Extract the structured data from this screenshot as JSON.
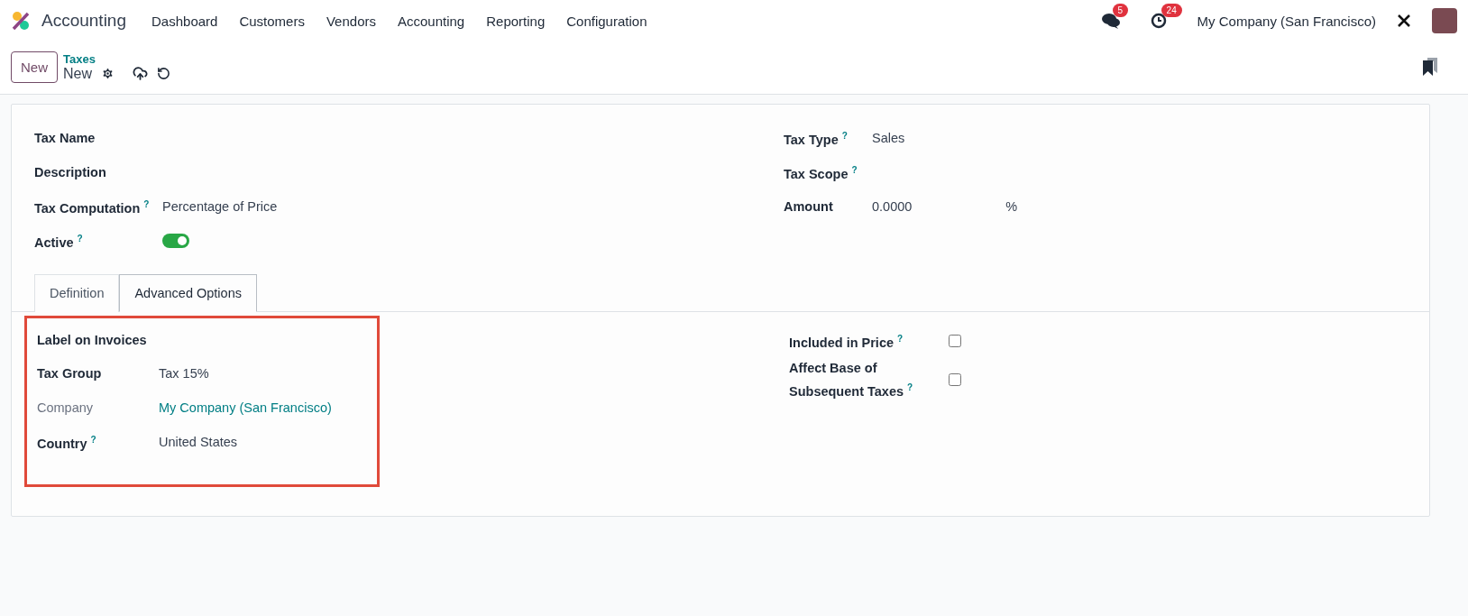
{
  "navbar": {
    "app_name": "Accounting",
    "menu": [
      "Dashboard",
      "Customers",
      "Vendors",
      "Accounting",
      "Reporting",
      "Configuration"
    ],
    "messages_count": "5",
    "activities_count": "24",
    "company": "My Company (San Francisco)"
  },
  "control_panel": {
    "new_button": "New",
    "breadcrumb_parent": "Taxes",
    "breadcrumb_current": "New"
  },
  "main_fields_left": [
    {
      "kind": "empty",
      "label": "Tax Name"
    },
    {
      "kind": "empty",
      "label": "Description"
    },
    {
      "kind": "text",
      "label": "Tax Computation",
      "help": "?",
      "value": "Percentage of Price"
    },
    {
      "kind": "toggle",
      "label": "Active",
      "help": "?",
      "on": true
    }
  ],
  "main_fields_right": [
    {
      "kind": "text",
      "label": "Tax Type",
      "help": "?",
      "value": "Sales"
    },
    {
      "kind": "empty",
      "label": "Tax Scope",
      "help": "?"
    },
    {
      "kind": "amount",
      "label": "Amount",
      "value": "0.0000",
      "unit": "%"
    }
  ],
  "tabs": [
    {
      "label": "Definition",
      "selected": false
    },
    {
      "label": "Advanced Options",
      "selected": true
    }
  ],
  "tab_content": {
    "highlighted": true,
    "section_title": "Label on Invoices",
    "fields": [
      {
        "kind": "text",
        "label": "Tax Group",
        "value": "Tax 15%"
      },
      {
        "kind": "link",
        "label": "Company",
        "value": "My Company (San Francisco)"
      },
      {
        "kind": "text",
        "label": "Country",
        "help": "?",
        "value": "United States"
      }
    ],
    "options": [
      {
        "label": "Included in Price",
        "help": "?",
        "checked": false
      },
      {
        "label": "Affect Base of Subsequent Taxes",
        "help": "?",
        "checked": false
      }
    ]
  }
}
